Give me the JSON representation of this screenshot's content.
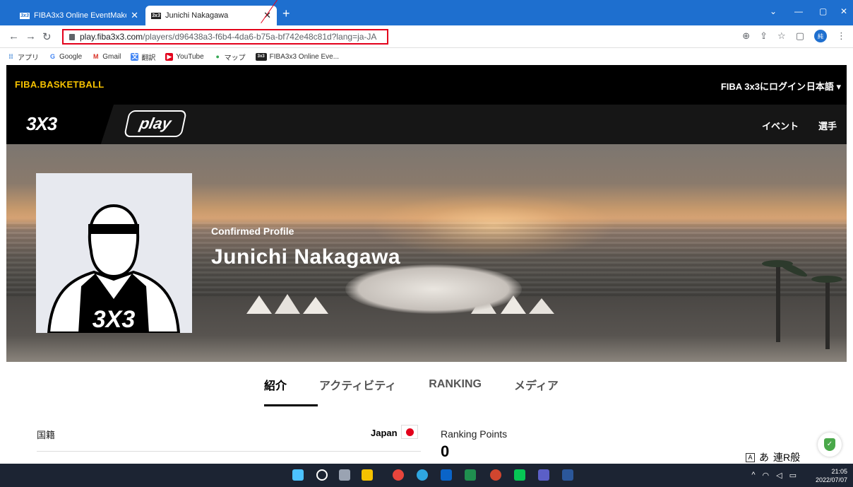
{
  "browser": {
    "tabs": [
      {
        "favicon": "3x3",
        "title": "FIBA3x3 Online EventMaker"
      },
      {
        "favicon": "3x3",
        "title": "Junichi Nakagawa"
      }
    ],
    "url_host": "play.fiba3x3.com",
    "url_path": "/players/d96438a3-f6b4-4da6-b75a-bf742e48c81d?lang=ja-JA",
    "bookmarks": [
      "アプリ",
      "Google",
      "Gmail",
      "翻訳",
      "YouTube",
      "マップ",
      "FIBA3x3 Online Eve..."
    ]
  },
  "site": {
    "fiba_logo": "FIBA.BASKETBALL",
    "login": "FIBA 3x3にログイン",
    "language": "日本語 ▾",
    "logo_3x3": "3X3",
    "logo_play": "play",
    "nav": [
      "イベント",
      "選手"
    ]
  },
  "hero": {
    "profile_status": "Confirmed Profile",
    "player_name": "Junichi Nakagawa",
    "jersey_logo": "3X3"
  },
  "tabs": [
    {
      "label": "紹介",
      "active": true
    },
    {
      "label": "アクティビティ",
      "active": false
    },
    {
      "label": "RANKING",
      "active": false
    },
    {
      "label": "メディア",
      "active": false
    }
  ],
  "profile": {
    "nationality_label": "国籍",
    "nationality_value": "Japan",
    "ranking_points_label": "Ranking Points",
    "ranking_points_value": "0"
  },
  "ime": {
    "mode": "あ",
    "text": "連R般"
  },
  "taskbar": {
    "time": "21:05",
    "date": "2022/07/07"
  },
  "colors": {
    "tab_bar": "#1e6fcf",
    "fiba_yellow": "#f6c200",
    "highlight_red": "#e3001b"
  }
}
